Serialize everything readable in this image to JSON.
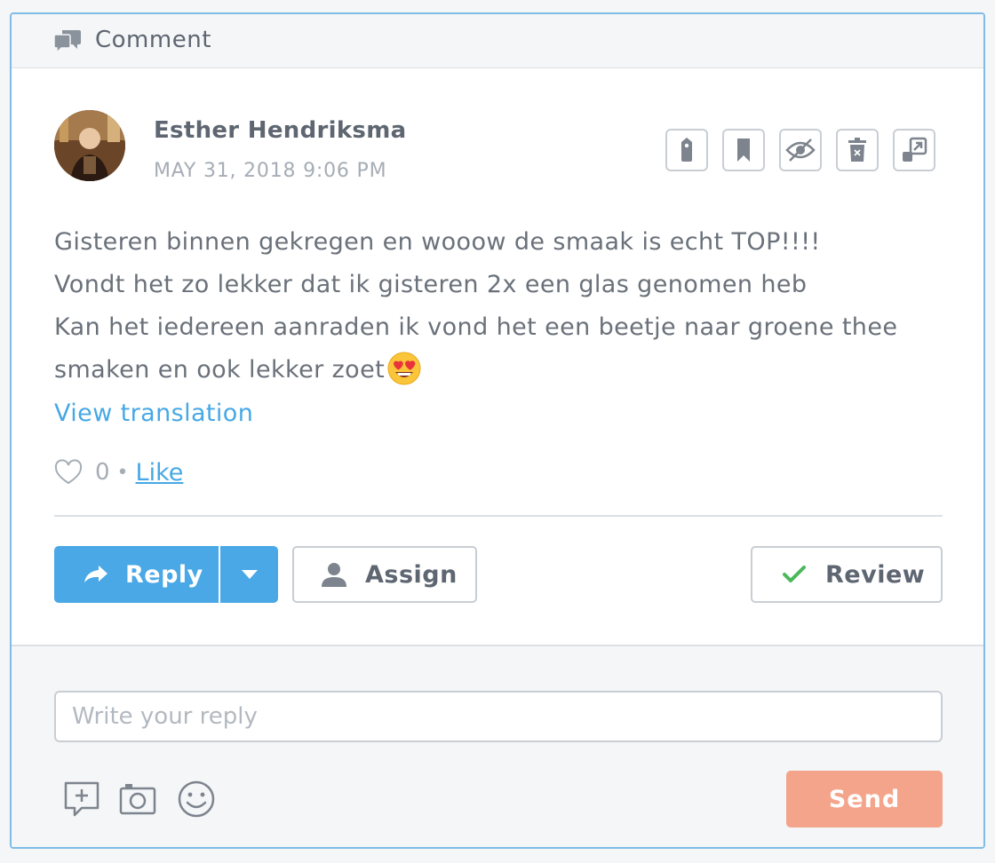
{
  "header": {
    "title": "Comment",
    "icon": "comments-icon"
  },
  "comment": {
    "author": "Esther Hendriksma",
    "timestamp": "MAY 31, 2018 9:06 PM",
    "lines": [
      "Gisteren binnen gekregen en wooow de smaak is echt TOP!!!!",
      "Vondt het zo lekker dat ik gisteren 2x een glas genomen heb",
      "Kan het iedereen aanraden ik vond het een beetje naar groene thee",
      "smaken en ook lekker zoet"
    ],
    "emoji": "heart-eyes-emoji",
    "view_translation": "View translation",
    "like_count": "0",
    "like_separator": "•",
    "like_label": "Like"
  },
  "toolbar": {
    "icons": [
      "tag-icon",
      "bookmark-icon",
      "hide-icon",
      "delete-icon",
      "external-link-icon"
    ]
  },
  "actions": {
    "reply_label": "Reply",
    "assign_label": "Assign",
    "review_label": "Review"
  },
  "reply_box": {
    "placeholder": "Write your reply",
    "value": "",
    "send_label": "Send",
    "icons": [
      "add-note-icon",
      "camera-icon",
      "smiley-icon"
    ]
  },
  "colors": {
    "accent": "#4aa8e6",
    "link": "#47a8e5",
    "send": "#f4a48a",
    "check": "#4cb85c",
    "border": "#7fbde6"
  }
}
